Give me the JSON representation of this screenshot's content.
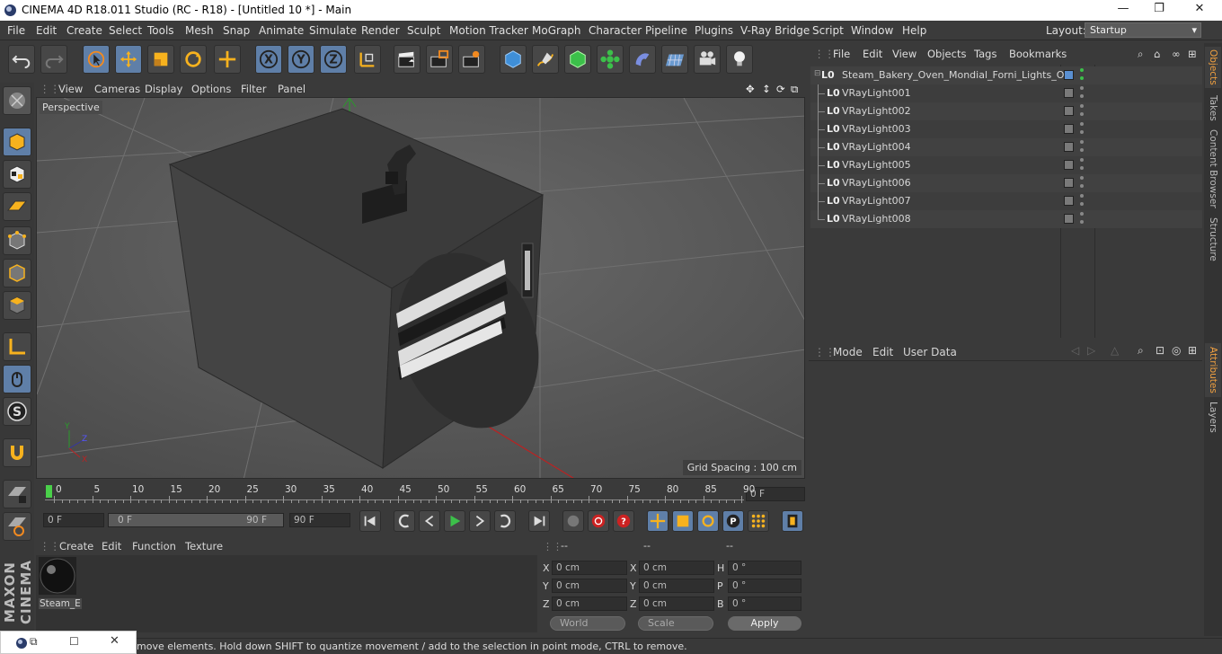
{
  "window": {
    "title": "CINEMA 4D R18.011 Studio (RC - R18) - [Untitled 10 *] - Main",
    "minimize": "—",
    "maximize": "❐",
    "close": "✕"
  },
  "menubar": {
    "items": [
      "File",
      "Edit",
      "Create",
      "Select",
      "Tools",
      "Mesh",
      "Snap",
      "Animate",
      "Simulate",
      "Render",
      "Sculpt",
      "Motion Tracker",
      "MoGraph",
      "Character",
      "Pipeline",
      "Plugins",
      "V-Ray Bridge",
      "Script",
      "Window",
      "Help"
    ],
    "layout_label": "Layout:",
    "layout_value": "Startup"
  },
  "viewport": {
    "menu": [
      "View",
      "Cameras",
      "Display",
      "Options",
      "Filter",
      "Panel"
    ],
    "label": "Perspective",
    "grid_spacing": "Grid Spacing : 100 cm"
  },
  "timeline": {
    "ticks": [
      "0",
      "5",
      "10",
      "15",
      "20",
      "25",
      "30",
      "35",
      "40",
      "45",
      "50",
      "55",
      "60",
      "65",
      "70",
      "75",
      "80",
      "85",
      "90"
    ],
    "current_frame": "0 F"
  },
  "transport": {
    "start": "0 F",
    "range_start": "0 F",
    "range_end": "90 F",
    "end": "90 F"
  },
  "materials": {
    "menu": [
      "Create",
      "Edit",
      "Function",
      "Texture"
    ],
    "items": [
      {
        "name": "Steam_E"
      }
    ]
  },
  "coordinates": {
    "headers": [
      "--",
      "--",
      "--"
    ],
    "rows": [
      {
        "a": "X",
        "av": "0 cm",
        "b": "X",
        "bv": "0 cm",
        "c": "H",
        "cv": "0 °"
      },
      {
        "a": "Y",
        "av": "0 cm",
        "b": "Y",
        "bv": "0 cm",
        "c": "P",
        "cv": "0 °"
      },
      {
        "a": "Z",
        "av": "0 cm",
        "b": "Z",
        "bv": "0 cm",
        "c": "B",
        "cv": "0 °"
      }
    ],
    "mode1": "World",
    "mode2": "Scale",
    "apply": "Apply"
  },
  "objects": {
    "menu": [
      "File",
      "Edit",
      "View",
      "Objects",
      "Tags",
      "Bookmarks"
    ],
    "items": [
      {
        "name": "Steam_Bakery_Oven_Mondial_Forni_Lights_On"
      },
      {
        "name": "VRayLight001"
      },
      {
        "name": "VRayLight002"
      },
      {
        "name": "VRayLight003"
      },
      {
        "name": "VRayLight004"
      },
      {
        "name": "VRayLight005"
      },
      {
        "name": "VRayLight006"
      },
      {
        "name": "VRayLight007"
      },
      {
        "name": "VRayLight008"
      }
    ]
  },
  "attributes": {
    "menu": [
      "Mode",
      "Edit",
      "User Data"
    ]
  },
  "right_tabs": [
    "Objects",
    "Takes",
    "Content Browser",
    "Structure",
    "Attributes",
    "Layers"
  ],
  "status": "move elements. Hold down SHIFT to quantize movement / add to the selection in point mode, CTRL to remove.",
  "brand": "MAXON CINEMA 4D",
  "colors": {
    "accent": "#5f7fa8",
    "active_tab": "#f0a040"
  }
}
